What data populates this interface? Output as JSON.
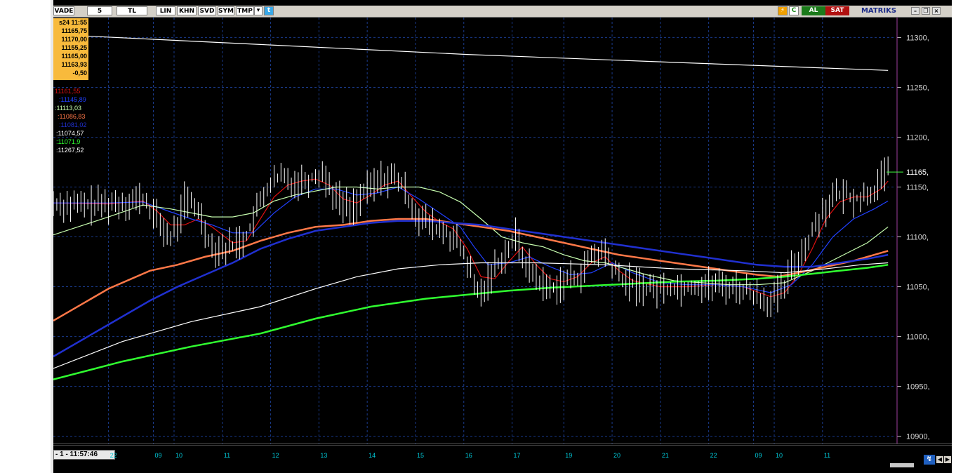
{
  "toolbar": {
    "buttons": [
      "VADE",
      "5",
      "TL",
      "LIN",
      "KHN",
      "SVD",
      "SYM",
      "TMP"
    ],
    "buy_label": "AL",
    "sell_label": "SAT",
    "brand": "MATRIKS",
    "colors": {
      "buy": "#1a7a1a",
      "sell": "#b01010"
    }
  },
  "quote_box": {
    "time": "s24 11:55",
    "values": [
      "11165,75",
      "11170,00",
      "11155,25",
      "11165,00",
      "11163,93",
      "-0,50"
    ]
  },
  "indicators": [
    {
      "label": "11161,55",
      "color": "#e01010"
    },
    {
      "label": ":11145,89",
      "color": "#2040ff"
    },
    {
      "label": ":11113,03",
      "color": "#c8ffb0"
    },
    {
      "label": ":11086,83",
      "color": "#ff7848"
    },
    {
      "label": ":11081,02",
      "color": "#2030d0"
    },
    {
      "label": ":11074,57",
      "color": "#ffffff"
    },
    {
      "label": ":11071,9",
      "color": "#30ff30"
    },
    {
      "label": ":11267,52",
      "color": "#ffffff"
    }
  ],
  "status": {
    "clock": "- 1 - 11:57:46"
  },
  "chart_data": {
    "type": "line",
    "y_ticks": [
      {
        "value": 11300,
        "label": "11300,"
      },
      {
        "value": 11250,
        "label": "11250,"
      },
      {
        "value": 11200,
        "label": "11200,"
      },
      {
        "value": 11150,
        "label": "11150,"
      },
      {
        "value": 11100,
        "label": "11100,"
      },
      {
        "value": 11050,
        "label": "11050,"
      },
      {
        "value": 11000,
        "label": "11000,"
      },
      {
        "value": 10950,
        "label": "10950,"
      },
      {
        "value": 10900,
        "label": "10900,"
      }
    ],
    "ylim": [
      10892,
      11320
    ],
    "last_price": {
      "value": 11165,
      "label": "11165,"
    },
    "x_tick_labels": [
      "22",
      "09",
      "10",
      "11",
      "12",
      "13",
      "14",
      "15",
      "16",
      "17",
      "19",
      "20",
      "21",
      "22",
      "09",
      "10",
      "11"
    ],
    "x_tick_positions": [
      8,
      14.5,
      17.5,
      24.5,
      31.5,
      38.5,
      45.5,
      52.5,
      59.5,
      66.5,
      74,
      81,
      88,
      95,
      101.5,
      104.5,
      111.5
    ],
    "xlim": [
      0,
      122
    ],
    "grid": true,
    "price": [
      [
        0,
        11134
      ],
      [
        4,
        11131
      ],
      [
        8,
        11133
      ],
      [
        13,
        11138
      ],
      [
        15,
        11118
      ],
      [
        17,
        11098
      ],
      [
        18,
        11112
      ],
      [
        19,
        11136
      ],
      [
        21,
        11128
      ],
      [
        23,
        11090
      ],
      [
        25,
        11089
      ],
      [
        26,
        11092
      ],
      [
        28,
        11100
      ],
      [
        29,
        11118
      ],
      [
        31,
        11150
      ],
      [
        33,
        11160
      ],
      [
        35,
        11155
      ],
      [
        37,
        11158
      ],
      [
        39,
        11165
      ],
      [
        41,
        11140
      ],
      [
        43,
        11128
      ],
      [
        44,
        11135
      ],
      [
        46,
        11150
      ],
      [
        48,
        11160
      ],
      [
        50,
        11158
      ],
      [
        51,
        11145
      ],
      [
        53,
        11120
      ],
      [
        55,
        11110
      ],
      [
        57,
        11103
      ],
      [
        58,
        11100
      ],
      [
        60,
        11075
      ],
      [
        61,
        11050
      ],
      [
        62,
        11042
      ],
      [
        64,
        11070
      ],
      [
        66,
        11088
      ],
      [
        67,
        11100
      ],
      [
        68,
        11082
      ],
      [
        69,
        11068
      ],
      [
        71,
        11052
      ],
      [
        72,
        11048
      ],
      [
        74,
        11055
      ],
      [
        76,
        11060
      ],
      [
        77,
        11068
      ],
      [
        78,
        11080
      ],
      [
        80,
        11085
      ],
      [
        81,
        11070
      ],
      [
        82,
        11060
      ],
      [
        84,
        11052
      ],
      [
        87,
        11048
      ],
      [
        91,
        11050
      ],
      [
        96,
        11052
      ],
      [
        100,
        11048
      ],
      [
        104,
        11035
      ],
      [
        106,
        11048
      ],
      [
        107,
        11068
      ],
      [
        109,
        11090
      ],
      [
        111,
        11120
      ],
      [
        113,
        11140
      ],
      [
        115,
        11142
      ],
      [
        117,
        11138
      ],
      [
        119,
        11148
      ],
      [
        121,
        11165
      ]
    ],
    "series": [
      {
        "color": "#e01010",
        "values": [
          [
            0,
            11134
          ],
          [
            8,
            11133
          ],
          [
            13,
            11136
          ],
          [
            15,
            11126
          ],
          [
            17,
            11112
          ],
          [
            19,
            11112
          ],
          [
            21,
            11118
          ],
          [
            23,
            11110
          ],
          [
            26,
            11094
          ],
          [
            28,
            11096
          ],
          [
            30,
            11118
          ],
          [
            32,
            11140
          ],
          [
            34,
            11152
          ],
          [
            36,
            11156
          ],
          [
            38,
            11158
          ],
          [
            40,
            11152
          ],
          [
            42,
            11138
          ],
          [
            44,
            11134
          ],
          [
            46,
            11142
          ],
          [
            48,
            11152
          ],
          [
            50,
            11156
          ],
          [
            52,
            11140
          ],
          [
            54,
            11125
          ],
          [
            56,
            11115
          ],
          [
            58,
            11108
          ],
          [
            60,
            11088
          ],
          [
            62,
            11060
          ],
          [
            64,
            11058
          ],
          [
            66,
            11075
          ],
          [
            68,
            11090
          ],
          [
            70,
            11072
          ],
          [
            72,
            11058
          ],
          [
            74,
            11055
          ],
          [
            76,
            11060
          ],
          [
            78,
            11074
          ],
          [
            80,
            11080
          ],
          [
            82,
            11066
          ],
          [
            84,
            11056
          ],
          [
            88,
            11050
          ],
          [
            92,
            11050
          ],
          [
            96,
            11052
          ],
          [
            100,
            11050
          ],
          [
            104,
            11040
          ],
          [
            106,
            11044
          ],
          [
            108,
            11062
          ],
          [
            110,
            11088
          ],
          [
            112,
            11118
          ],
          [
            114,
            11135
          ],
          [
            116,
            11140
          ],
          [
            118,
            11140
          ],
          [
            120,
            11148
          ],
          [
            121,
            11156
          ]
        ]
      },
      {
        "color": "#2040ff",
        "values": [
          [
            0,
            11134
          ],
          [
            8,
            11134
          ],
          [
            13,
            11135
          ],
          [
            17,
            11125
          ],
          [
            20,
            11118
          ],
          [
            23,
            11112
          ],
          [
            26,
            11104
          ],
          [
            29,
            11104
          ],
          [
            32,
            11124
          ],
          [
            35,
            11140
          ],
          [
            38,
            11148
          ],
          [
            41,
            11148
          ],
          [
            44,
            11142
          ],
          [
            47,
            11144
          ],
          [
            50,
            11150
          ],
          [
            53,
            11138
          ],
          [
            56,
            11124
          ],
          [
            59,
            11110
          ],
          [
            61,
            11090
          ],
          [
            63,
            11072
          ],
          [
            66,
            11074
          ],
          [
            69,
            11080
          ],
          [
            72,
            11070
          ],
          [
            75,
            11062
          ],
          [
            78,
            11064
          ],
          [
            81,
            11074
          ],
          [
            84,
            11064
          ],
          [
            88,
            11054
          ],
          [
            92,
            11052
          ],
          [
            96,
            11052
          ],
          [
            100,
            11050
          ],
          [
            104,
            11044
          ],
          [
            107,
            11052
          ],
          [
            110,
            11072
          ],
          [
            113,
            11100
          ],
          [
            116,
            11118
          ],
          [
            119,
            11128
          ],
          [
            121,
            11136
          ]
        ]
      },
      {
        "color": "#c8ffb0",
        "values": [
          [
            0,
            11102
          ],
          [
            8,
            11120
          ],
          [
            13,
            11132
          ],
          [
            17,
            11128
          ],
          [
            20,
            11124
          ],
          [
            23,
            11120
          ],
          [
            26,
            11120
          ],
          [
            29,
            11124
          ],
          [
            32,
            11136
          ],
          [
            35,
            11142
          ],
          [
            38,
            11146
          ],
          [
            41,
            11150
          ],
          [
            44,
            11150
          ],
          [
            47,
            11148
          ],
          [
            50,
            11150
          ],
          [
            53,
            11150
          ],
          [
            56,
            11145
          ],
          [
            59,
            11135
          ],
          [
            62,
            11118
          ],
          [
            65,
            11100
          ],
          [
            68,
            11094
          ],
          [
            71,
            11090
          ],
          [
            74,
            11082
          ],
          [
            77,
            11076
          ],
          [
            80,
            11074
          ],
          [
            83,
            11068
          ],
          [
            86,
            11062
          ],
          [
            90,
            11056
          ],
          [
            94,
            11054
          ],
          [
            98,
            11052
          ],
          [
            102,
            11052
          ],
          [
            106,
            11054
          ],
          [
            110,
            11066
          ],
          [
            114,
            11080
          ],
          [
            118,
            11094
          ],
          [
            121,
            11110
          ]
        ]
      },
      {
        "color": "#ff7848",
        "values": [
          [
            0,
            11016
          ],
          [
            8,
            11048
          ],
          [
            14,
            11066
          ],
          [
            18,
            11072
          ],
          [
            22,
            11080
          ],
          [
            26,
            11086
          ],
          [
            30,
            11096
          ],
          [
            34,
            11104
          ],
          [
            38,
            11110
          ],
          [
            42,
            11112
          ],
          [
            46,
            11116
          ],
          [
            50,
            11118
          ],
          [
            54,
            11118
          ],
          [
            58,
            11114
          ],
          [
            62,
            11110
          ],
          [
            66,
            11106
          ],
          [
            70,
            11100
          ],
          [
            74,
            11094
          ],
          [
            78,
            11088
          ],
          [
            82,
            11082
          ],
          [
            86,
            11078
          ],
          [
            90,
            11074
          ],
          [
            94,
            11070
          ],
          [
            98,
            11066
          ],
          [
            102,
            11062
          ],
          [
            105,
            11060
          ],
          [
            108,
            11064
          ],
          [
            112,
            11070
          ],
          [
            116,
            11076
          ],
          [
            121,
            11086
          ]
        ]
      },
      {
        "color": "#2030d0",
        "values": [
          [
            0,
            10980
          ],
          [
            8,
            11012
          ],
          [
            14,
            11036
          ],
          [
            18,
            11050
          ],
          [
            22,
            11062
          ],
          [
            26,
            11074
          ],
          [
            30,
            11088
          ],
          [
            34,
            11098
          ],
          [
            38,
            11106
          ],
          [
            42,
            11110
          ],
          [
            46,
            11114
          ],
          [
            50,
            11116
          ],
          [
            54,
            11116
          ],
          [
            58,
            11114
          ],
          [
            62,
            11112
          ],
          [
            66,
            11108
          ],
          [
            70,
            11104
          ],
          [
            74,
            11100
          ],
          [
            78,
            11096
          ],
          [
            82,
            11092
          ],
          [
            86,
            11088
          ],
          [
            90,
            11084
          ],
          [
            94,
            11080
          ],
          [
            98,
            11076
          ],
          [
            102,
            11072
          ],
          [
            106,
            11070
          ],
          [
            110,
            11070
          ],
          [
            114,
            11074
          ],
          [
            118,
            11078
          ],
          [
            121,
            11082
          ]
        ]
      },
      {
        "color": "#ffffff",
        "values": [
          [
            0,
            10968
          ],
          [
            10,
            10995
          ],
          [
            20,
            11015
          ],
          [
            30,
            11030
          ],
          [
            38,
            11048
          ],
          [
            44,
            11060
          ],
          [
            50,
            11068
          ],
          [
            56,
            11072
          ],
          [
            62,
            11074
          ],
          [
            70,
            11074
          ],
          [
            80,
            11072
          ],
          [
            90,
            11068
          ],
          [
            100,
            11066
          ],
          [
            106,
            11064
          ],
          [
            112,
            11068
          ],
          [
            117,
            11072
          ],
          [
            121,
            11074
          ]
        ]
      },
      {
        "color": "#30ff30",
        "values": [
          [
            0,
            10957
          ],
          [
            10,
            10975
          ],
          [
            20,
            10990
          ],
          [
            30,
            11003
          ],
          [
            38,
            11018
          ],
          [
            46,
            11030
          ],
          [
            54,
            11038
          ],
          [
            60,
            11042
          ],
          [
            66,
            11046
          ],
          [
            72,
            11049
          ],
          [
            78,
            11051
          ],
          [
            84,
            11053
          ],
          [
            90,
            11055
          ],
          [
            96,
            11056
          ],
          [
            102,
            11058
          ],
          [
            106,
            11060
          ],
          [
            110,
            11063
          ],
          [
            114,
            11066
          ],
          [
            118,
            11069
          ],
          [
            121,
            11072
          ]
        ]
      },
      {
        "color": "#ffffff",
        "values": [
          [
            0,
            11303
          ],
          [
            30,
            11293
          ],
          [
            60,
            11283
          ],
          [
            90,
            11275
          ],
          [
            121,
            11267
          ]
        ]
      }
    ]
  }
}
